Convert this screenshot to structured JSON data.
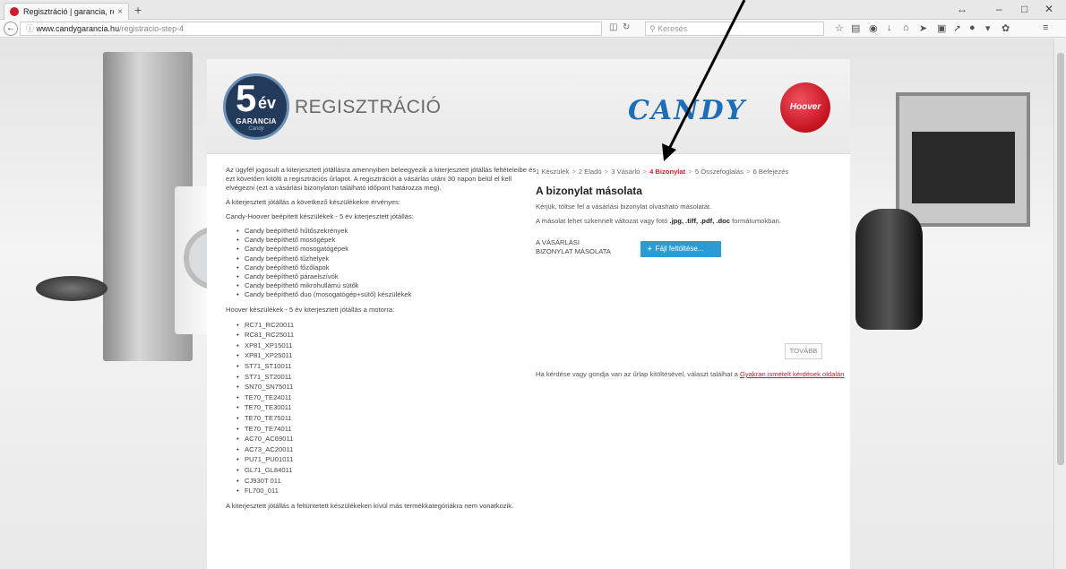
{
  "browser": {
    "tab_title": "Regisztráció | garancia, re...",
    "tab_close": "×",
    "new_tab": "+",
    "url_host": "www.candygarancia.hu",
    "url_path": "/registracio-step-4",
    "search_placeholder": "Keresés"
  },
  "header": {
    "badge_number": "5",
    "badge_unit": "év",
    "badge_label": "GARANCIA",
    "badge_brand": "Candy",
    "title": "REGISZTRÁCIÓ",
    "candy_logo": "CANDY",
    "hoover_logo": "Hoover"
  },
  "left": {
    "intro": "Az ügyfél jogosult a kiterjesztett jótállásra amennyiben beleegyezik a kiterjesztett jótállás feltételeibe és ezt követően kitölti a regisztrációs űrlapot. A regisztrációt a vásárlás utáni 30 napon belül el kell elvégezni (ezt a vásárlási bizonylaton található időpont határozza meg).",
    "valid_for": "A kiterjesztett jótállás a következő készülékekre érvényes:",
    "candy_heading": "Candy-Hoover beépített készülékek - 5 év kiterjesztett jótállás:",
    "candy_items": [
      "Candy beépíthető hűtőszekrények",
      "Candy beépíthető mosógépek",
      "Candy beépíthető mosogatógépek",
      "Candy beépíthető tűzhelyek",
      "Candy beépíthető főzőlapok",
      "Candy beépíthető páraelszívók",
      "Candy beépíthető mikrohullámú sütők",
      "Candy beépíthető duo (mosogatógép+sütő) készülékek"
    ],
    "hoover_heading": "Hoover készülékek - 5 év kiterjesztett jótállás a motorra:",
    "hoover_items": [
      "RC71_RC20011",
      "RC81_RC25011",
      "XP81_XP15011",
      "XP81_XP25011",
      "ST71_ST10011",
      "ST71_ST20011",
      "SN70_SN75011",
      "TE70_TE24011",
      "TE70_TE30011",
      "TE70_TE75011",
      "TE70_TE74011",
      "AC70_AC69011",
      "AC73_AC20011",
      "PU71_PU01011",
      "GL71_GL84011",
      "CJ930T 011",
      "FL700_011"
    ],
    "footer": "A kiterjesztett jótállás a feltüntetett készülékeken kívül más termékkategóriákra nem vonatkozik."
  },
  "steps": [
    {
      "label": "1 Készülék",
      "active": false
    },
    {
      "label": "2 Eladó",
      "active": false
    },
    {
      "label": "3 Vásárló",
      "active": false
    },
    {
      "label": "4 Bizonylat",
      "active": true
    },
    {
      "label": "5 Összefoglalás",
      "active": false
    },
    {
      "label": "6 Befejezés",
      "active": false
    }
  ],
  "steps_separator": ">",
  "form": {
    "title": "A bizonylat másolata",
    "instruction": "Kérjük, töltse fel a vásárlási bizonylat olvasható másolatát.",
    "formats_prefix": "A másolat lehet szkennelt változat vagy fotó",
    "formats": ".jpg, .tiff, .pdf, .doc",
    "formats_suffix": "formátumokban.",
    "upload_label_line1": "A VÁSÁRLÁSI",
    "upload_label_line2": "BIZONYLAT MÁSOLATA",
    "upload_button": "Fájl feltöltése...",
    "upload_button_icon": "+",
    "next_button": "TOVÁBB",
    "help_prefix": "Ha kérdése vagy gondja van az űrlap kitöltésével, választ találhat a",
    "help_link": "Gyakran ismételt kérdések oldalán"
  },
  "colors": {
    "accent_red": "#d41b2c",
    "upload_blue": "#2b9bd4",
    "candy_blue": "#1d6eb7"
  },
  "icons": [
    "back-arrow-icon",
    "info-icon",
    "reload-icon",
    "search-icon",
    "star-icon",
    "download-icon",
    "home-icon",
    "menu-icon",
    "hoover-logo-icon"
  ]
}
